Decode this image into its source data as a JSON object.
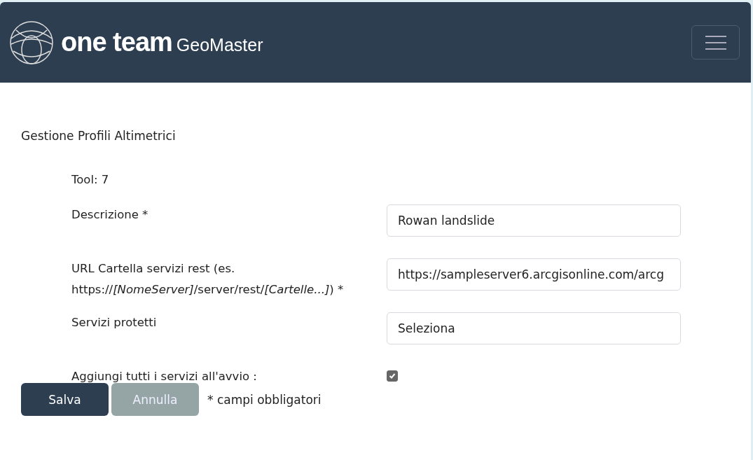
{
  "header": {
    "brand": "one team",
    "product": "GeoMaster"
  },
  "page_title": "Gestione Profili Altimetrici",
  "form": {
    "rows": [
      {
        "kind": "info",
        "label": "Tool: 7"
      },
      {
        "kind": "input",
        "label": "Descrizione",
        "required_mark": "*",
        "value": "Rowan landslide"
      },
      {
        "kind": "input",
        "label": "URL Cartella servizi rest (es. https://*[NomeServer]*/server/rest/*[Cartelle...]*)",
        "required_mark": "*",
        "value": "https://sampleserver6.arcgisonline.com/arcg"
      },
      {
        "kind": "input",
        "label": "Servizi protetti",
        "value": "Seleziona"
      },
      {
        "kind": "checkbox",
        "label": "Aggiungi tutti i servizi all'avvio :",
        "checked": true
      }
    ]
  },
  "buttons": [
    {
      "label": "Salva",
      "disabled": false
    },
    {
      "label": "Annulla",
      "disabled": true
    }
  ],
  "footnote": "* campi obbligatori"
}
